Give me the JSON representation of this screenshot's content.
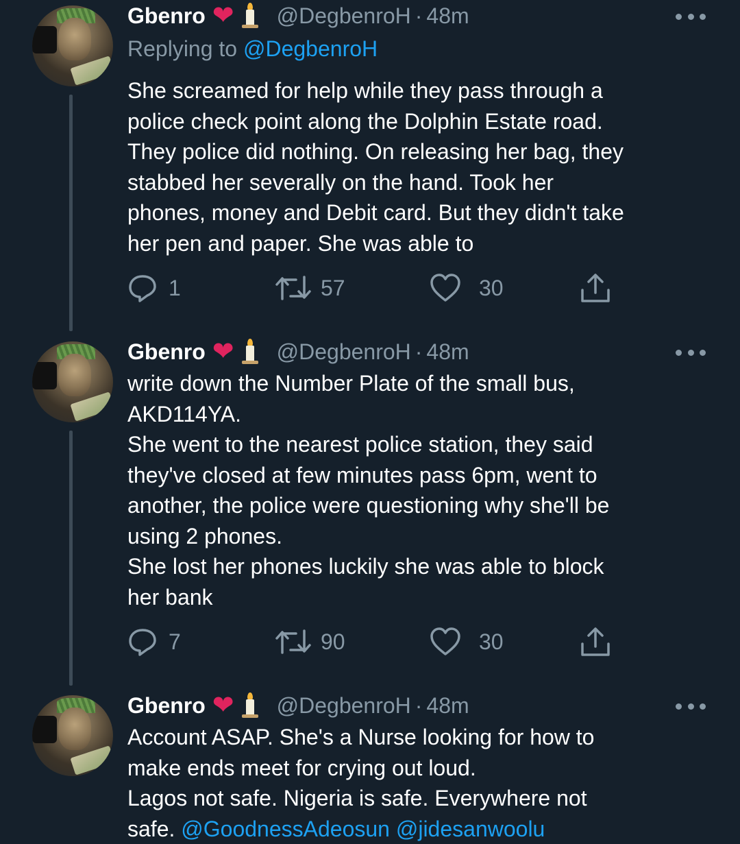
{
  "tweets": [
    {
      "name": "Gbenro",
      "heart": "❤",
      "handle": "@DegbenroH",
      "dot": "·",
      "time": "48m",
      "replying_prefix": "Replying to",
      "replying_handle": "@DegbenroH",
      "body": "She screamed for help while they pass through a\npolice check point along the Dolphin Estate road.\nThey police did nothing. On releasing her bag, they\nstabbed her severally on the hand. Took her\nphones, money and Debit card. But they didn't take\nher pen and paper. She was able to",
      "replies": "1",
      "retweets": "57",
      "likes": "30"
    },
    {
      "name": "Gbenro",
      "heart": "❤",
      "handle": "@DegbenroH",
      "dot": "·",
      "time": "48m",
      "body": "write down the Number Plate of the small bus,\nAKD114YA.\nShe went to the nearest police station, they said\nthey've closed at few minutes pass 6pm, went to\nanother, the police were questioning why she'll be\nusing 2 phones.\nShe lost her phones luckily she was able to block\nher bank",
      "replies": "7",
      "retweets": "90",
      "likes": "30"
    },
    {
      "name": "Gbenro",
      "heart": "❤",
      "handle": "@DegbenroH",
      "dot": "·",
      "time": "48m",
      "body": "Account ASAP. She's a Nurse looking for how to\nmake ends meet for crying out loud.\nLagos not safe. Nigeria is safe. Everywhere  not\nsafe.",
      "mention_1": "@GoodnessAdeosun",
      "mention_2": "@jidesanwoolu"
    }
  ],
  "icons": [
    "reply-icon",
    "retweet-icon",
    "like-icon",
    "share-icon",
    "more-icon",
    "candle-emoji",
    "heart-emoji"
  ],
  "colors": {
    "background": "#15202b",
    "text": "#ffffff",
    "muted": "#8899a6",
    "link": "#1da1f2",
    "heart": "#e0245e",
    "thread": "#3d4b57"
  }
}
